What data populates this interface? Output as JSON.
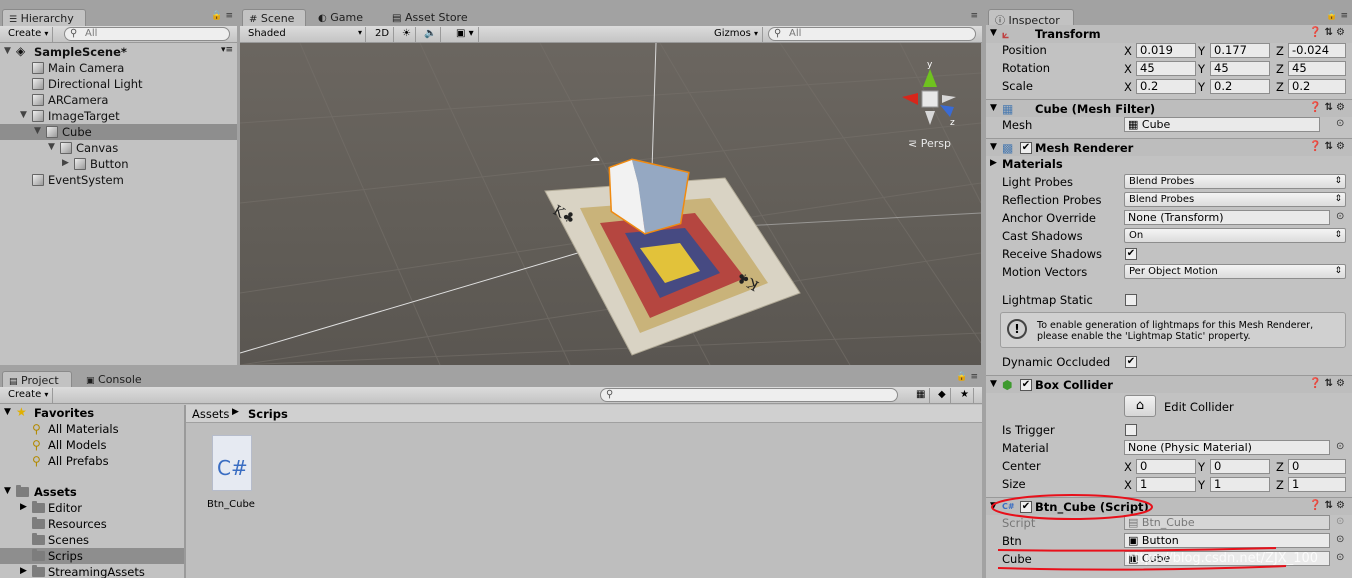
{
  "hierarchy": {
    "tab": "Hierarchy",
    "create_label": "Create",
    "search_placeholder": "All",
    "scene_name": "SampleScene*",
    "items": [
      "Main Camera",
      "Directional Light",
      "ARCamera",
      "ImageTarget",
      "Cube",
      "Canvas",
      "Button",
      "EventSystem"
    ]
  },
  "scene_tabs": {
    "scene": "Scene",
    "game": "Game",
    "asset_store": "Asset Store"
  },
  "scene_toolbar": {
    "shading": "Shaded",
    "mode_2d": "2D",
    "gizmos": "Gizmos",
    "search_placeholder": "All"
  },
  "scene_view": {
    "persp_label": "Persp",
    "axis_y": "y",
    "axis_z": "z"
  },
  "project": {
    "tab": "Project",
    "console_tab": "Console",
    "create_label": "Create",
    "favorites_label": "Favorites",
    "favorites": [
      "All Materials",
      "All Models",
      "All Prefabs"
    ],
    "assets_label": "Assets",
    "folders": [
      "Editor",
      "Resources",
      "Scenes",
      "Scrips",
      "StreamingAssets"
    ],
    "breadcrumb_root": "Assets",
    "breadcrumb_current": "Scrips",
    "file_name": "Btn_Cube",
    "file_badge": "C#"
  },
  "inspector": {
    "tab": "Inspector",
    "transform": {
      "title": "Transform",
      "rows": [
        {
          "label": "Position",
          "x": "0.019",
          "y": "0.177",
          "z": "-0.024"
        },
        {
          "label": "Rotation",
          "x": "45",
          "y": "45",
          "z": "45"
        },
        {
          "label": "Scale",
          "x": "0.2",
          "y": "0.2",
          "z": "0.2"
        }
      ]
    },
    "mesh_filter": {
      "title": "Cube (Mesh Filter)",
      "mesh_label": "Mesh",
      "mesh_value": "Cube"
    },
    "mesh_renderer": {
      "title": "Mesh Renderer",
      "materials_label": "Materials",
      "light_probes_label": "Light Probes",
      "light_probes_value": "Blend Probes",
      "reflection_probes_label": "Reflection Probes",
      "reflection_probes_value": "Blend Probes",
      "anchor_override_label": "Anchor Override",
      "anchor_override_value": "None (Transform)",
      "cast_shadows_label": "Cast Shadows",
      "cast_shadows_value": "On",
      "receive_shadows_label": "Receive Shadows",
      "motion_vectors_label": "Motion Vectors",
      "motion_vectors_value": "Per Object Motion",
      "lightmap_static_label": "Lightmap Static",
      "info_line1": "To enable generation of lightmaps for this Mesh Renderer,",
      "info_line2": "please enable the 'Lightmap Static' property.",
      "dynamic_occluded_label": "Dynamic Occluded"
    },
    "box_collider": {
      "title": "Box Collider",
      "edit_label": "Edit Collider",
      "is_trigger_label": "Is Trigger",
      "material_label": "Material",
      "material_value": "None (Physic Material)",
      "center": {
        "label": "Center",
        "x": "0",
        "y": "0",
        "z": "0"
      },
      "size": {
        "label": "Size",
        "x": "1",
        "y": "1",
        "z": "1"
      }
    },
    "script": {
      "title": "Btn_Cube (Script)",
      "script_label": "Script",
      "script_value": "Btn_Cube",
      "btn_label": "Btn",
      "btn_value": "Button",
      "cube_label": "Cube",
      "cube_value": "Cube"
    },
    "axes": {
      "x": "X",
      "y": "Y",
      "z": "Z"
    }
  },
  "watermark": "https://blog.csdn.net/ZJX_100"
}
